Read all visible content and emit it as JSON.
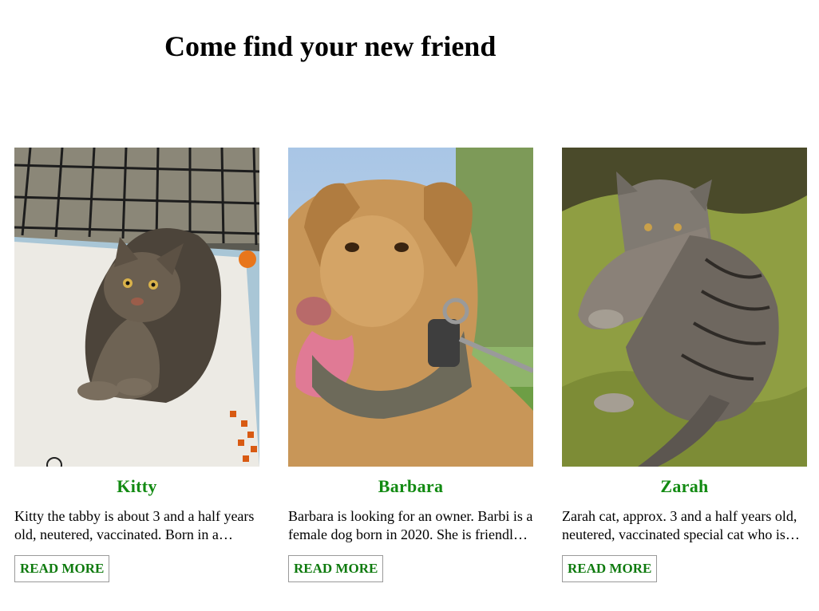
{
  "page": {
    "title": "Come find your new friend"
  },
  "pets": [
    {
      "name": "Kitty",
      "description": "Kitty the tabby is about 3 and a half years old, neutered, vaccinated. Born in a shelter and now waiting for a loving home.",
      "button_label": "READ MORE"
    },
    {
      "name": "Barbara",
      "description": "Barbara is looking for an owner. Barbi is a female dog born in 2020. She is friendly and loves walks.",
      "button_label": "READ MORE"
    },
    {
      "name": "Zarah",
      "description": "Zarah cat, approx. 3 and a half years old, neutered, vaccinated special cat who is looking for a calm home.",
      "button_label": "READ MORE"
    }
  ],
  "colors": {
    "name_green": "#128a12",
    "button_green": "#0e7a0e"
  }
}
